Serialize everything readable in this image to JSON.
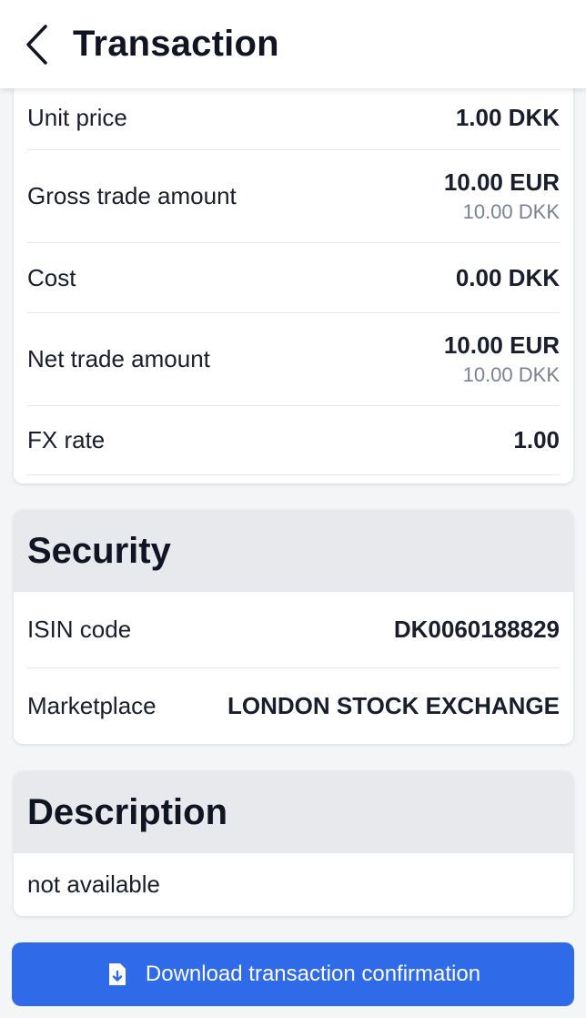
{
  "header": {
    "title": "Transaction",
    "back_icon": "chevron-left-icon"
  },
  "trade": {
    "rows": [
      {
        "label": "Unit price",
        "value": "1.00 DKK",
        "sub": ""
      },
      {
        "label": "Gross trade amount",
        "value": "10.00 EUR",
        "sub": "10.00 DKK"
      },
      {
        "label": "Cost",
        "value": "0.00 DKK",
        "sub": ""
      },
      {
        "label": "Net trade amount",
        "value": "10.00 EUR",
        "sub": "10.00 DKK"
      },
      {
        "label": "FX rate",
        "value": "1.00",
        "sub": ""
      }
    ]
  },
  "security": {
    "heading": "Security",
    "rows": [
      {
        "label": "ISIN code",
        "value": "DK0060188829"
      },
      {
        "label": "Marketplace",
        "value": "LONDON STOCK EXCHANGE"
      }
    ]
  },
  "description": {
    "heading": "Description",
    "text": "not available"
  },
  "download": {
    "label": "Download transaction confirmation",
    "icon": "file-download-icon"
  },
  "colors": {
    "accent": "#2f6ae8",
    "section_header_bg": "#e8e9ec",
    "secondary_text": "#7b8190"
  }
}
